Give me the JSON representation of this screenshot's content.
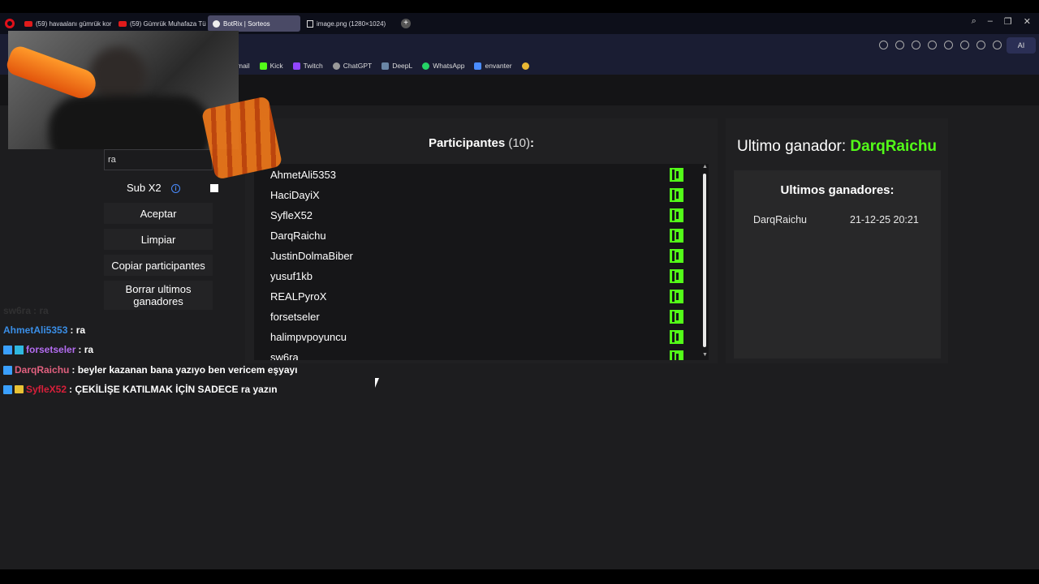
{
  "browser": {
    "tabs": [
      {
        "label": "(59) havaalanı gümrük kor",
        "icon": "youtube-icon"
      },
      {
        "label": "(59) Gümrük Muhafaza Tü",
        "icon": "youtube-icon"
      },
      {
        "label": "BotRix | Sorteos",
        "icon": "botrix-icon",
        "active": true
      },
      {
        "label": "image.png (1280×1024)",
        "icon": "image-icon"
      }
    ],
    "new_tab": "+",
    "ai_button": "AI",
    "bookmarks": [
      {
        "label": "mail",
        "color": "#d44"
      },
      {
        "label": "Kick",
        "color": "#53fc18"
      },
      {
        "label": "Twitch",
        "color": "#9146ff"
      },
      {
        "label": "ChatGPT",
        "color": "#aaa"
      },
      {
        "label": "DeepL",
        "color": "#0f2b46"
      },
      {
        "label": "WhatsApp",
        "color": "#25d366"
      },
      {
        "label": "envanter",
        "color": "#4a8cff"
      }
    ]
  },
  "controls": {
    "search_value": "ra",
    "sub_x2_label": "Sub X2",
    "sub_x2_checked": false,
    "accept_label": "Aceptar",
    "clear_label": "Limpiar",
    "copy_label": "Copiar participantes",
    "delete_winners_label": "Borrar ultimos ganadores"
  },
  "chat": [
    {
      "user": "sw6ra",
      "message": ": ra",
      "color": "#555555",
      "badges": [],
      "faded": true
    },
    {
      "user": "AhmetAli5353",
      "message": ": ra",
      "color": "#3a8ee6",
      "badges": []
    },
    {
      "user": "forsetseler",
      "message": ": ra",
      "color": "#b36cf0",
      "badges": [
        "badge",
        "badge2"
      ]
    },
    {
      "user": "DarqRaichu",
      "message": ": beyler kazanan bana yazıyo ben vericem eşyayı",
      "color": "#e0607e",
      "badges": [
        "badge"
      ]
    },
    {
      "user": "SyfleX52",
      "message": ": ÇEKİLİŞE KATILMAK İÇİN SADECE ra yazın",
      "color": "#d81f3a",
      "badges": [
        "badge",
        "crown"
      ]
    }
  ],
  "participants": {
    "title": "Participantes",
    "count": "(10)",
    "colon": ":",
    "names": [
      "AhmetAli5353",
      "HaciDayiX",
      "SyfleX52",
      "DarqRaichu",
      "JustinDolmaBiber",
      "yusuf1kb",
      "REALPyroX",
      "forsetseler",
      "halimpvpoyuncu",
      "sw6ra"
    ],
    "platform_icon": "kick-icon"
  },
  "winner": {
    "label": "Ultimo ganador:",
    "name": "DarqRaichu"
  },
  "last_winners": {
    "title": "Ultimos ganadores:",
    "rows": [
      {
        "name": "DarqRaichu",
        "date": "21-12-25 20:21"
      }
    ]
  }
}
